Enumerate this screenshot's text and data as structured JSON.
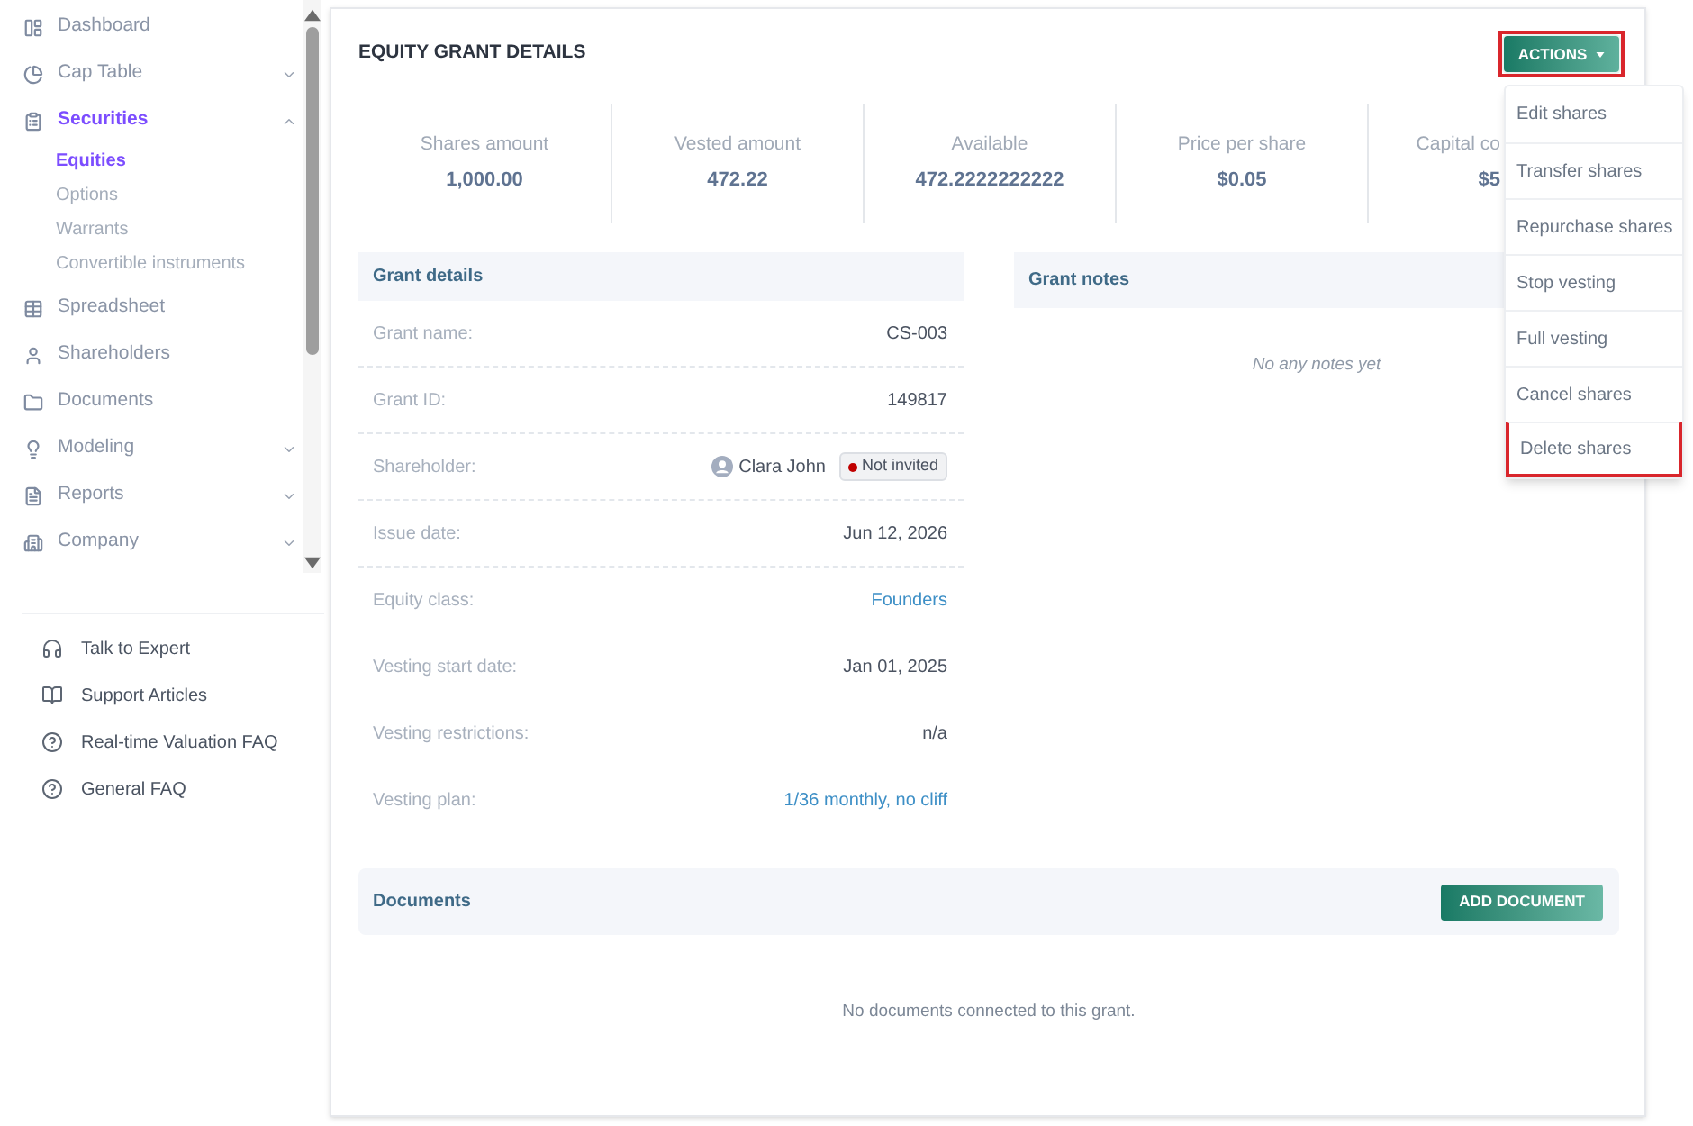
{
  "sidebar": {
    "items": [
      {
        "kind": "link",
        "label": "Dashboard",
        "selected": false
      },
      {
        "kind": "group",
        "label": "Cap Table",
        "selected": false,
        "expanded": false
      },
      {
        "kind": "group",
        "label": "Securities",
        "selected": true,
        "expanded": true,
        "children": [
          {
            "label": "Equities",
            "selected": true
          },
          {
            "label": "Options",
            "selected": false
          },
          {
            "label": "Warrants",
            "selected": false
          },
          {
            "label": "Convertible instruments",
            "selected": false
          }
        ]
      },
      {
        "kind": "link",
        "label": "Spreadsheet",
        "selected": false
      },
      {
        "kind": "link",
        "label": "Shareholders",
        "selected": false
      },
      {
        "kind": "link",
        "label": "Documents",
        "selected": false
      },
      {
        "kind": "group",
        "label": "Modeling",
        "selected": false,
        "expanded": false
      },
      {
        "kind": "group",
        "label": "Reports",
        "selected": false,
        "expanded": false
      },
      {
        "kind": "group",
        "label": "Company",
        "selected": false,
        "expanded": false
      }
    ],
    "help_links": [
      {
        "label": "Talk to Expert"
      },
      {
        "label": "Support Articles"
      },
      {
        "label": "Real-time Valuation FAQ"
      },
      {
        "label": "General FAQ"
      }
    ]
  },
  "page": {
    "title": "EQUITY GRANT DETAILS",
    "actions": {
      "label": "ACTIONS",
      "highlighted": true,
      "menu_open": true,
      "menu": [
        {
          "label": "Edit shares",
          "highlighted": false
        },
        {
          "label": "Transfer shares",
          "highlighted": false
        },
        {
          "label": "Repurchase shares",
          "highlighted": false
        },
        {
          "label": "Stop vesting",
          "highlighted": false
        },
        {
          "label": "Full vesting",
          "highlighted": false
        },
        {
          "label": "Cancel shares",
          "highlighted": false
        },
        {
          "label": "Delete shares",
          "highlighted": true
        }
      ]
    }
  },
  "stats": [
    {
      "label": "Shares amount",
      "value": "1,000.00"
    },
    {
      "label": "Vested amount",
      "value": "472.22"
    },
    {
      "label": "Available",
      "value": "472.2222222222"
    },
    {
      "label": "Price per share",
      "value": "$0.05"
    },
    {
      "label": "Capital co",
      "value": "$5"
    }
  ],
  "grant_details": {
    "title": "Grant details",
    "rows": [
      {
        "kind": "text",
        "label": "Grant name:",
        "value": "CS-003",
        "divider": true
      },
      {
        "kind": "text",
        "label": "Grant ID:",
        "value": "149817",
        "divider": true
      },
      {
        "kind": "person",
        "label": "Shareholder:",
        "value": "Clara John",
        "badge": "Not invited",
        "divider": true
      },
      {
        "kind": "text",
        "label": "Issue date:",
        "value": "Jun 12, 2026",
        "divider": true
      },
      {
        "kind": "link",
        "label": "Equity class:",
        "value": "Founders",
        "divider": false
      },
      {
        "kind": "text",
        "label": "Vesting start date:",
        "value": "Jan 01, 2025",
        "divider": false
      },
      {
        "kind": "text",
        "label": "Vesting restrictions:",
        "value": "n/a",
        "divider": false
      },
      {
        "kind": "link",
        "label": "Vesting plan:",
        "value": "1/36 monthly, no cliff",
        "divider": false
      }
    ]
  },
  "grant_notes": {
    "title": "Grant notes",
    "empty_text": "No any notes yet"
  },
  "documents": {
    "title": "Documents",
    "button": "ADD DOCUMENT",
    "empty_text": "No documents connected to this grant."
  }
}
